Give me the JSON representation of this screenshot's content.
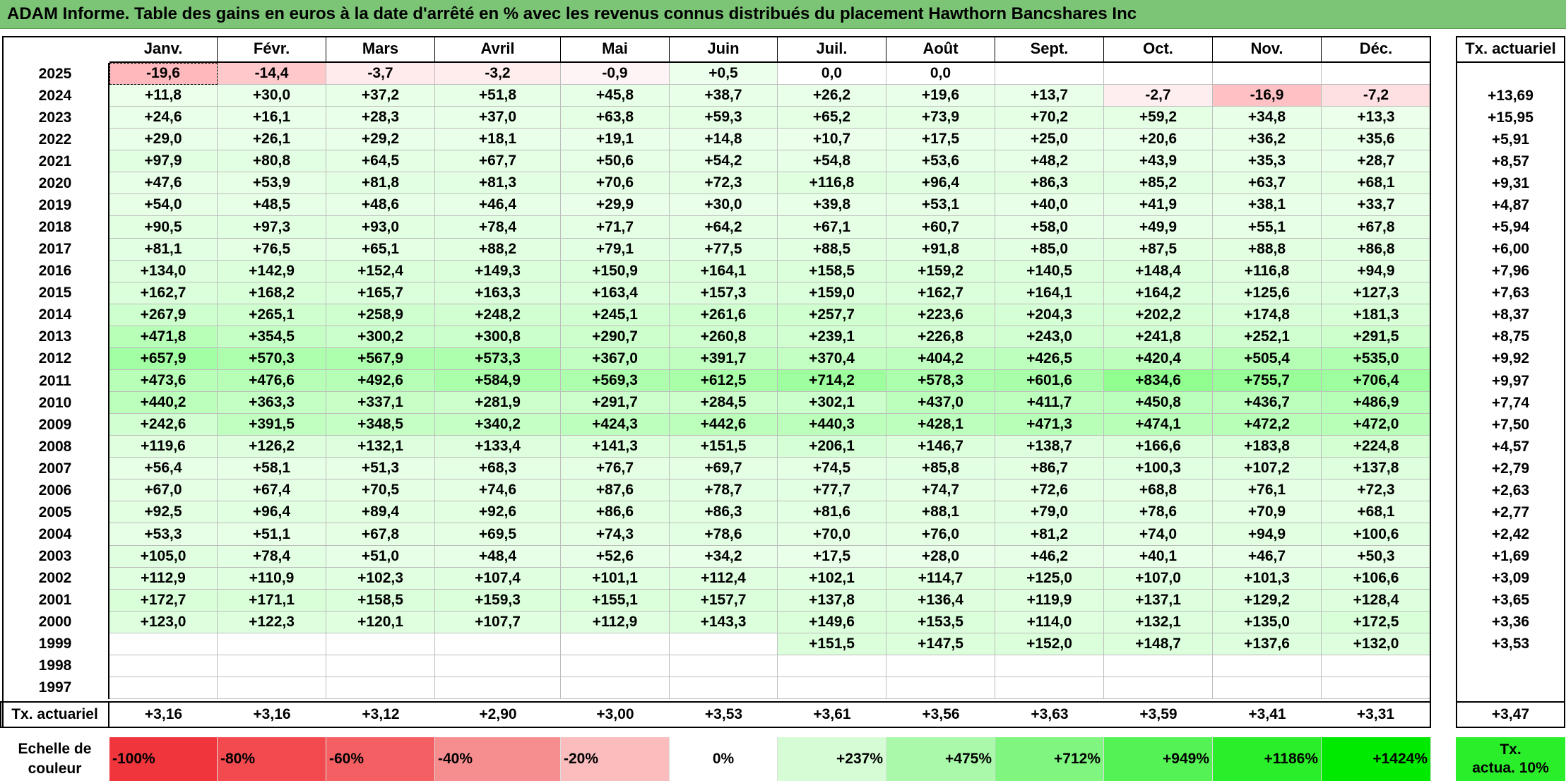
{
  "title": "ADAM Informe. Table des gains en euros à la date d'arrêté en % avec les revenus connus distribués du placement Hawthorn Bancshares Inc",
  "months": [
    "Janv.",
    "Févr.",
    "Mars",
    "Avril",
    "Mai",
    "Juin",
    "Juil.",
    "Août",
    "Sept.",
    "Oct.",
    "Nov.",
    "Déc."
  ],
  "rate_header": "Tx. actuariel",
  "rows": [
    {
      "year": "2025",
      "values": [
        "-19,6",
        "-14,4",
        "-3,7",
        "-3,2",
        "-0,9",
        "+0,5",
        "0,0",
        "0,0",
        "",
        "",
        "",
        ""
      ],
      "rate": ""
    },
    {
      "year": "2024",
      "values": [
        "+11,8",
        "+30,0",
        "+37,2",
        "+51,8",
        "+45,8",
        "+38,7",
        "+26,2",
        "+19,6",
        "+13,7",
        "-2,7",
        "-16,9",
        "-7,2"
      ],
      "rate": "+13,69"
    },
    {
      "year": "2023",
      "values": [
        "+24,6",
        "+16,1",
        "+28,3",
        "+37,0",
        "+63,8",
        "+59,3",
        "+65,2",
        "+73,9",
        "+70,2",
        "+59,2",
        "+34,8",
        "+13,3"
      ],
      "rate": "+15,95"
    },
    {
      "year": "2022",
      "values": [
        "+29,0",
        "+26,1",
        "+29,2",
        "+18,1",
        "+19,1",
        "+14,8",
        "+10,7",
        "+17,5",
        "+25,0",
        "+20,6",
        "+36,2",
        "+35,6"
      ],
      "rate": "+5,91"
    },
    {
      "year": "2021",
      "values": [
        "+97,9",
        "+80,8",
        "+64,5",
        "+67,7",
        "+50,6",
        "+54,2",
        "+54,8",
        "+53,6",
        "+48,2",
        "+43,9",
        "+35,3",
        "+28,7"
      ],
      "rate": "+8,57"
    },
    {
      "year": "2020",
      "values": [
        "+47,6",
        "+53,9",
        "+81,8",
        "+81,3",
        "+70,6",
        "+72,3",
        "+116,8",
        "+96,4",
        "+86,3",
        "+85,2",
        "+63,7",
        "+68,1"
      ],
      "rate": "+9,31"
    },
    {
      "year": "2019",
      "values": [
        "+54,0",
        "+48,5",
        "+48,6",
        "+46,4",
        "+29,9",
        "+30,0",
        "+39,8",
        "+53,1",
        "+40,0",
        "+41,9",
        "+38,1",
        "+33,7"
      ],
      "rate": "+4,87"
    },
    {
      "year": "2018",
      "values": [
        "+90,5",
        "+97,3",
        "+93,0",
        "+78,4",
        "+71,7",
        "+64,2",
        "+67,1",
        "+60,7",
        "+58,0",
        "+49,9",
        "+55,1",
        "+67,8"
      ],
      "rate": "+5,94"
    },
    {
      "year": "2017",
      "values": [
        "+81,1",
        "+76,5",
        "+65,1",
        "+88,2",
        "+79,1",
        "+77,5",
        "+88,5",
        "+91,8",
        "+85,0",
        "+87,5",
        "+88,8",
        "+86,8"
      ],
      "rate": "+6,00"
    },
    {
      "year": "2016",
      "values": [
        "+134,0",
        "+142,9",
        "+152,4",
        "+149,3",
        "+150,9",
        "+164,1",
        "+158,5",
        "+159,2",
        "+140,5",
        "+148,4",
        "+116,8",
        "+94,9"
      ],
      "rate": "+7,96"
    },
    {
      "year": "2015",
      "values": [
        "+162,7",
        "+168,2",
        "+165,7",
        "+163,3",
        "+163,4",
        "+157,3",
        "+159,0",
        "+162,7",
        "+164,1",
        "+164,2",
        "+125,6",
        "+127,3"
      ],
      "rate": "+7,63"
    },
    {
      "year": "2014",
      "values": [
        "+267,9",
        "+265,1",
        "+258,9",
        "+248,2",
        "+245,1",
        "+261,6",
        "+257,7",
        "+223,6",
        "+204,3",
        "+202,2",
        "+174,8",
        "+181,3"
      ],
      "rate": "+8,37"
    },
    {
      "year": "2013",
      "values": [
        "+471,8",
        "+354,5",
        "+300,2",
        "+300,8",
        "+290,7",
        "+260,8",
        "+239,1",
        "+226,8",
        "+243,0",
        "+241,8",
        "+252,1",
        "+291,5"
      ],
      "rate": "+8,75"
    },
    {
      "year": "2012",
      "values": [
        "+657,9",
        "+570,3",
        "+567,9",
        "+573,3",
        "+367,0",
        "+391,7",
        "+370,4",
        "+404,2",
        "+426,5",
        "+420,4",
        "+505,4",
        "+535,0"
      ],
      "rate": "+9,92"
    },
    {
      "year": "2011",
      "values": [
        "+473,6",
        "+476,6",
        "+492,6",
        "+584,9",
        "+569,3",
        "+612,5",
        "+714,2",
        "+578,3",
        "+601,6",
        "+834,6",
        "+755,7",
        "+706,4"
      ],
      "rate": "+9,97"
    },
    {
      "year": "2010",
      "values": [
        "+440,2",
        "+363,3",
        "+337,1",
        "+281,9",
        "+291,7",
        "+284,5",
        "+302,1",
        "+437,0",
        "+411,7",
        "+450,8",
        "+436,7",
        "+486,9"
      ],
      "rate": "+7,74"
    },
    {
      "year": "2009",
      "values": [
        "+242,6",
        "+391,5",
        "+348,5",
        "+340,2",
        "+424,3",
        "+442,6",
        "+440,3",
        "+428,1",
        "+471,3",
        "+474,1",
        "+472,2",
        "+472,0"
      ],
      "rate": "+7,50"
    },
    {
      "year": "2008",
      "values": [
        "+119,6",
        "+126,2",
        "+132,1",
        "+133,4",
        "+141,3",
        "+151,5",
        "+206,1",
        "+146,7",
        "+138,7",
        "+166,6",
        "+183,8",
        "+224,8"
      ],
      "rate": "+4,57"
    },
    {
      "year": "2007",
      "values": [
        "+56,4",
        "+58,1",
        "+51,3",
        "+68,3",
        "+76,7",
        "+69,7",
        "+74,5",
        "+85,8",
        "+86,7",
        "+100,3",
        "+107,2",
        "+137,8"
      ],
      "rate": "+2,79"
    },
    {
      "year": "2006",
      "values": [
        "+67,0",
        "+67,4",
        "+70,5",
        "+74,6",
        "+87,6",
        "+78,7",
        "+77,7",
        "+74,7",
        "+72,6",
        "+68,8",
        "+76,1",
        "+72,3"
      ],
      "rate": "+2,63"
    },
    {
      "year": "2005",
      "values": [
        "+92,5",
        "+96,4",
        "+89,4",
        "+92,6",
        "+86,6",
        "+86,3",
        "+81,6",
        "+88,1",
        "+79,0",
        "+78,6",
        "+70,9",
        "+68,1"
      ],
      "rate": "+2,77"
    },
    {
      "year": "2004",
      "values": [
        "+53,3",
        "+51,1",
        "+67,8",
        "+69,5",
        "+74,3",
        "+78,6",
        "+70,0",
        "+76,0",
        "+81,2",
        "+74,0",
        "+94,9",
        "+100,6"
      ],
      "rate": "+2,42"
    },
    {
      "year": "2003",
      "values": [
        "+105,0",
        "+78,4",
        "+51,0",
        "+48,4",
        "+52,6",
        "+34,2",
        "+17,5",
        "+28,0",
        "+46,2",
        "+40,1",
        "+46,7",
        "+50,3"
      ],
      "rate": "+1,69"
    },
    {
      "year": "2002",
      "values": [
        "+112,9",
        "+110,9",
        "+102,3",
        "+107,4",
        "+101,1",
        "+112,4",
        "+102,1",
        "+114,7",
        "+125,0",
        "+107,0",
        "+101,3",
        "+106,6"
      ],
      "rate": "+3,09"
    },
    {
      "year": "2001",
      "values": [
        "+172,7",
        "+171,1",
        "+158,5",
        "+159,3",
        "+155,1",
        "+157,7",
        "+137,8",
        "+136,4",
        "+119,9",
        "+137,1",
        "+129,2",
        "+128,4"
      ],
      "rate": "+3,65"
    },
    {
      "year": "2000",
      "values": [
        "+123,0",
        "+122,3",
        "+120,1",
        "+107,7",
        "+112,9",
        "+143,3",
        "+149,6",
        "+153,5",
        "+114,0",
        "+132,1",
        "+135,0",
        "+172,5"
      ],
      "rate": "+3,36"
    },
    {
      "year": "1999",
      "values": [
        "",
        "",
        "",
        "",
        "",
        "",
        "+151,5",
        "+147,5",
        "+152,0",
        "+148,7",
        "+137,6",
        "+132,0"
      ],
      "rate": "+3,53"
    },
    {
      "year": "1998",
      "values": [
        "",
        "",
        "",
        "",
        "",
        "",
        "",
        "",
        "",
        "",
        "",
        ""
      ],
      "rate": ""
    },
    {
      "year": "1997",
      "values": [
        "",
        "",
        "",
        "",
        "",
        "",
        "",
        "",
        "",
        "",
        "",
        ""
      ],
      "rate": ""
    }
  ],
  "footer": {
    "label": "Tx. actuariel",
    "values": [
      "+3,16",
      "+3,16",
      "+3,12",
      "+2,90",
      "+3,00",
      "+3,53",
      "+3,61",
      "+3,56",
      "+3,63",
      "+3,59",
      "+3,41",
      "+3,31"
    ],
    "rate": "+3,47"
  },
  "scale": {
    "label_line1": "Echelle de",
    "label_line2": "couleur",
    "items": [
      {
        "text": "-100%",
        "color": "#f0363c"
      },
      {
        "text": "-80%",
        "color": "#f24a4f"
      },
      {
        "text": "-60%",
        "color": "#f45f63"
      },
      {
        "text": "-40%",
        "color": "#f68e90"
      },
      {
        "text": "-20%",
        "color": "#fabcbd"
      },
      {
        "text": "0%",
        "color": "#ffffff"
      },
      {
        "text": "+237%",
        "color": "#d5fcd5"
      },
      {
        "text": "+475%",
        "color": "#aaf9aa"
      },
      {
        "text": "+712%",
        "color": "#80f580"
      },
      {
        "text": "+949%",
        "color": "#55f255"
      },
      {
        "text": "+1186%",
        "color": "#2bee2b"
      },
      {
        "text": "+1424%",
        "color": "#00ea00"
      }
    ],
    "rate_line1": "Tx.",
    "rate_line2": "actua. 10%",
    "rate_color": "#2bee2b"
  }
}
